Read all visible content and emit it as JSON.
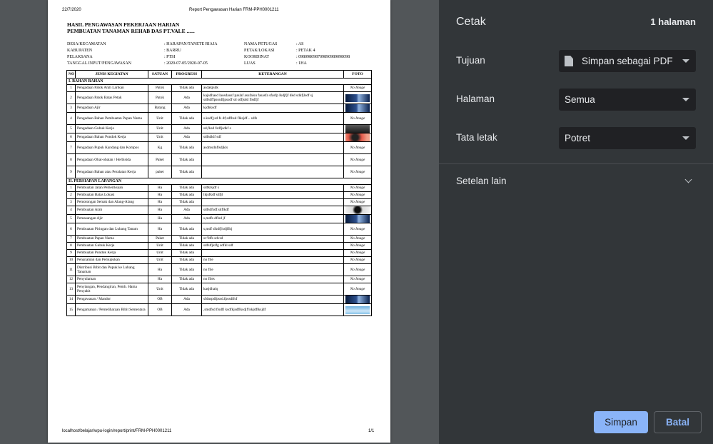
{
  "preview": {
    "header_date": "22/7/2020",
    "header_title": "Report Pengawasan Harian FRM-PPH0001211",
    "footer_url": "localhost/belajar/wpu-login/report/print/FRM-PPH0001211",
    "footer_page": "1/1",
    "doc_title_1": "HASIL PENGAWASAN PEKERJAAN HARIAN",
    "doc_title_2": "PEMBUATAN TANAMAN REHAB DAS PT.VALE ......",
    "info_left": [
      {
        "k": "DESA/KECAMATAN",
        "v": ": HARAPAN/TANETE RIAJA"
      },
      {
        "k": "KABUPATEN",
        "v": ": BARRU"
      },
      {
        "k": "PELAKSANA",
        "v": ": PTSI"
      },
      {
        "k": "TANGGAL INPUT/PENGAWASAN",
        "v": ": 2020-07-05/2020-07-05"
      }
    ],
    "info_right": [
      {
        "k": "NAMA PETUGAS",
        "v": ": AS"
      },
      {
        "k": "PETAK/LOKASI",
        "v": ": PETAK 4"
      },
      {
        "k": "KOORDINAT",
        "v": ": 098098098709890989098098"
      },
      {
        "k": "LUAS",
        "v": ": 1HA"
      }
    ],
    "table_headers": [
      "NO",
      "JENIS KEGIATAN",
      "SATUAN",
      "PROGRESS",
      "KETERANGAN",
      "FOTO"
    ],
    "section1_title": "I. BAHAN BAHAN",
    "section1_rows": [
      {
        "no": "1",
        "jenis": "Pengadaan Patok Arah Larikan",
        "satuan": "Patok",
        "progress": "Tidak ada",
        "ket": "asdakjsdk",
        "foto": "No Image",
        "thumb": ""
      },
      {
        "no": "2",
        "jenis": "Pengadaan Patok Batas Petak",
        "satuan": "Patok",
        "progress": "Ada",
        "ket": "kajsdhasd laosdausf paslaf asufaisu fasasfa sfasfp lkdjfjf dkd sdkfjlsdf sj sdfsdffpsssdfjpssdf sd sdfjsdd flsdfjf",
        "foto": "",
        "thumb": "blue"
      },
      {
        "no": "3",
        "jenis": "Pengadaan Ajir",
        "satuan": "Batang",
        "progress": "Ada",
        "ket": "kjdhksdf",
        "foto": "",
        "thumb": "blue"
      },
      {
        "no": "4",
        "jenis": "Pengadaan Bahan Pembuatan Papan Nama",
        "satuan": "Unit",
        "progress": "Tidak ada",
        "ket": "s.ksdfj;sd fs df;sdfhsd flksjdf... sdfs",
        "foto": "No Image",
        "thumb": ""
      },
      {
        "no": "5",
        "jenis": "Pengadaan Gubuk Kerja",
        "satuan": "Unit",
        "progress": "Ada",
        "ket": "sd,fksd fsdfjsdkf s",
        "foto": "",
        "thumb": "dark"
      },
      {
        "no": "6",
        "jenis": "Pengadaan Bahan Pondok Kerja",
        "satuan": "Unit",
        "progress": "Ada",
        "ket": "sdfsdklf sdf",
        "foto": "",
        "thumb": "red"
      },
      {
        "no": "7",
        "jenis": "Pengadaan Pupuk Kandang dan Kompos",
        "satuan": "Kg",
        "progress": "Tidak ada",
        "ket": "asdmsdnflsdjkls",
        "foto": "No Image",
        "thumb": ""
      },
      {
        "no": "8",
        "jenis": "Pengadaan Obat-obatan / Herbisida",
        "satuan": "Paket",
        "progress": "Tidak ada",
        "ket": "",
        "foto": "No Image",
        "thumb": ""
      },
      {
        "no": "9",
        "jenis": "Pengadaan Bahan atau Peralatan Kerja",
        "satuan": "paket",
        "progress": "Tidak ada",
        "ket": "",
        "foto": "No Image",
        "thumb": ""
      }
    ],
    "section2_title": "II. PERSIAPAN LAPANGAN",
    "section2_rows": [
      {
        "no": "1",
        "jenis": "Pembuatan Jalan Pemeriksaan",
        "satuan": "Ha",
        "progress": "Tidak ada",
        "ket": "sdfklsjdf s",
        "foto": "No Image",
        "thumb": ""
      },
      {
        "no": "2",
        "jenis": "Pembuatan Batas Lokasi",
        "satuan": "Ha",
        "progress": "Tidak ada",
        "ket": "lkjsfkdf sdfjl",
        "foto": "No Image",
        "thumb": ""
      },
      {
        "no": "3",
        "jenis": "Pemotongan Semak dan Alang-Alang",
        "satuan": "Ha",
        "progress": "Tidak ada",
        "ket": "",
        "foto": "No Image",
        "thumb": ""
      },
      {
        "no": "4",
        "jenis": "Pembuatan Arah",
        "satuan": "Ha",
        "progress": "Ada",
        "ket": "sdfsdfsdf.sdflkdf",
        "foto": "",
        "thumb": "person"
      },
      {
        "no": "5",
        "jenis": "Pemasangan Ajir",
        "satuan": "Ha",
        "progress": "Ada",
        "ket": "s,mdfs dflsd jf",
        "foto": "",
        "thumb": "blue"
      },
      {
        "no": "6",
        "jenis": "Pembuatan Piringan dan Lubang Tanam",
        "satuan": "Ha",
        "progress": "Tidak ada",
        "ket": "s,mdf slkdfjlsdjflkj",
        "foto": "No Image",
        "thumb": ""
      },
      {
        "no": "7",
        "jenis": "Pembuatan Papan Nama",
        "satuan": "Paket",
        "progress": "Tidak ada",
        "ket": "sv'fdfs sdvsd",
        "foto": "No Image",
        "thumb": ""
      },
      {
        "no": "8",
        "jenis": "Pembuatan Gubuk Kerja",
        "satuan": "Unit",
        "progress": "Tidak ada",
        "ket": "sdfslfjklfg sdfkl sdf",
        "foto": "No Image",
        "thumb": ""
      },
      {
        "no": "9",
        "jenis": "Pembuatan Pondok Kerja",
        "satuan": "Unit",
        "progress": "Tidak ada",
        "ket": "",
        "foto": "No Image",
        "thumb": ""
      },
      {
        "no": "10",
        "jenis": "Penanaman dan Pemupukan",
        "satuan": "Unit",
        "progress": "Tidak ada",
        "ket": "no file",
        "foto": "No Image",
        "thumb": ""
      },
      {
        "no": "11",
        "jenis": "Distribusi Bibit dan Pupuk ke Lubang Tanaman",
        "satuan": "Ha",
        "progress": "Tidak ada",
        "ket": "no file",
        "foto": "No Image",
        "thumb": ""
      },
      {
        "no": "12",
        "jenis": "Penyulaman",
        "satuan": "Ha",
        "progress": "Tidak ada",
        "ket": "no files",
        "foto": "No Image",
        "thumb": ""
      },
      {
        "no": "13",
        "jenis": "Penyiangan, Pendangiran, Pemb. Hama Penyakit",
        "satuan": "Unit",
        "progress": "Tidak ada",
        "ket": "kasjdhaiq",
        "foto": "No Image",
        "thumb": ""
      },
      {
        "no": "14",
        "jenis": "Pengawasan / Mandor",
        "satuan": "OB",
        "progress": "Ada",
        "ket": "sfdnspdfpssd.fpssdifsf",
        "foto": "",
        "thumb": "blue"
      },
      {
        "no": "15",
        "jenis": "Pengamanan / Pemeliharaan Bibit Sementara",
        "satuan": "OB",
        "progress": "Ada",
        "ket": ",smdfsd flsdfl ksdfkjsdflksdjf'lskjdflksjdf",
        "foto": "",
        "thumb": "lightblue"
      }
    ]
  },
  "panel": {
    "title": "Cetak",
    "pages_count": "1 halaman",
    "destination_label": "Tujuan",
    "destination_value": "Simpan sebagai PDF",
    "pages_label": "Halaman",
    "pages_value": "Semua",
    "layout_label": "Tata letak",
    "layout_value": "Potret",
    "more_settings_label": "Setelan lain",
    "save_button": "Simpan",
    "cancel_button": "Batal"
  },
  "colors": {
    "preview_bg": "#525659",
    "panel_bg": "#323639",
    "select_bg": "#202124",
    "accent": "#8ab4f8"
  }
}
